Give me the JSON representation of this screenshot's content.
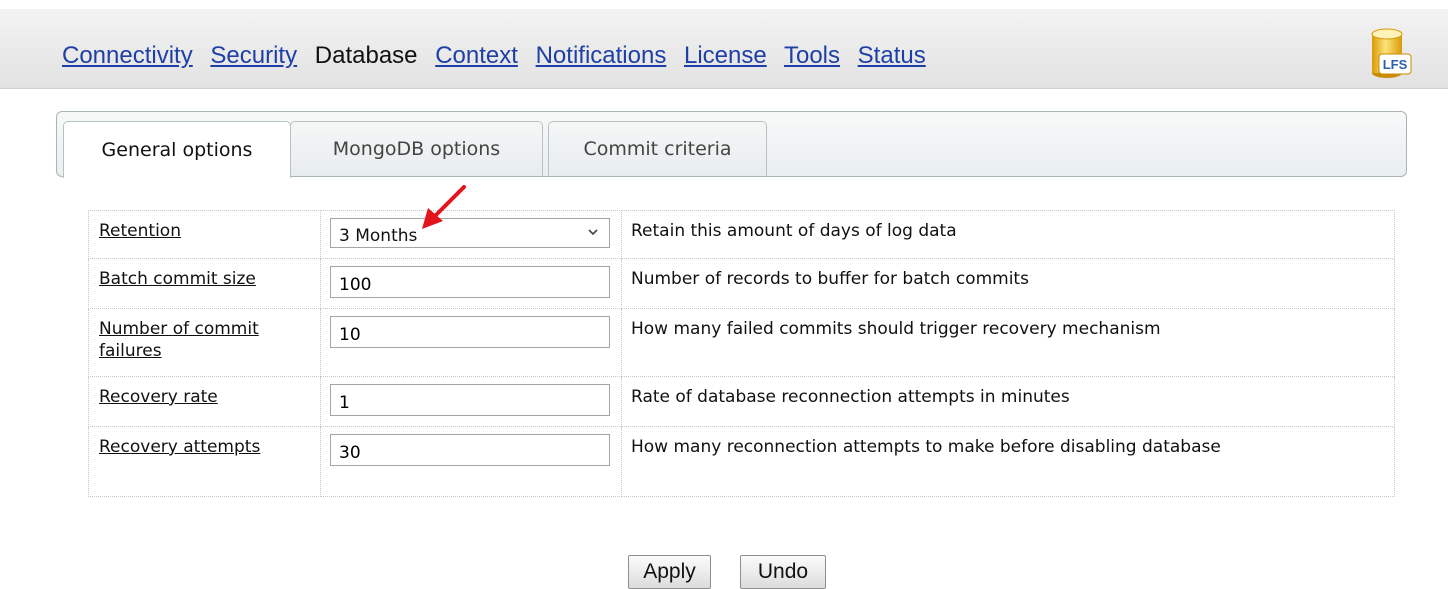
{
  "nav": {
    "items": [
      "Connectivity",
      "Security",
      "Database",
      "Context",
      "Notifications",
      "License",
      "Tools",
      "Status"
    ],
    "active": "Database"
  },
  "logo": {
    "text": "LFS",
    "icon": "database-cylinder-icon"
  },
  "tabs": [
    {
      "label": "General options",
      "active": true
    },
    {
      "label": "MongoDB options",
      "active": false
    },
    {
      "label": "Commit criteria",
      "active": false
    }
  ],
  "settings": [
    {
      "label": "Retention",
      "type": "select",
      "value": "3 Months",
      "description": "Retain this amount of days of log data"
    },
    {
      "label": "Batch commit size",
      "type": "text",
      "value": "100",
      "description": "Number of records to buffer for batch commits"
    },
    {
      "label": "Number of commit failures",
      "type": "text",
      "value": "10",
      "description": "How many failed commits should trigger recovery mechanism"
    },
    {
      "label": "Recovery rate",
      "type": "text",
      "value": "1",
      "description": "Rate of database reconnection attempts in minutes"
    },
    {
      "label": "Recovery attempts",
      "type": "text",
      "value": "30",
      "description": "How many reconnection attempts to make before disabling database"
    }
  ],
  "buttons": {
    "apply": "Apply",
    "undo": "Undo"
  },
  "colors": {
    "link": "#1e3fa6",
    "annotation_arrow": "#e3141b",
    "logo_gold": "#f0c21d"
  }
}
